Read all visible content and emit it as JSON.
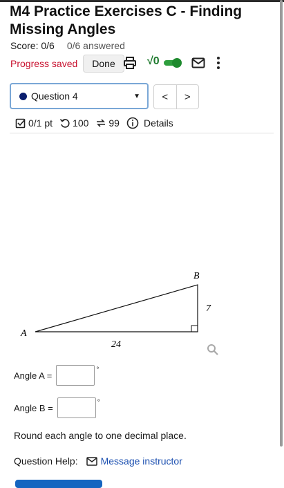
{
  "header": {
    "title": "M4 Practice Exercises C - Finding Missing Angles",
    "score": "Score: 0/6",
    "answered": "0/6 answered",
    "progress_saved": "Progress saved",
    "done_label": "Done",
    "sqrt_label": "√0",
    "icons": [
      "printer-icon",
      "toggle-switch",
      "mail-icon",
      "kebab-menu-icon"
    ]
  },
  "question_nav": {
    "selected": "Question 4",
    "prev_label": "<",
    "next_label": ">"
  },
  "stats": {
    "points": "0/1 pt",
    "attempts": "100",
    "retries": "99",
    "details": "Details"
  },
  "figure": {
    "vertex_a": "A",
    "vertex_b": "B",
    "side_vertical": "7",
    "side_base": "24"
  },
  "answers": {
    "angle_a_label": "Angle A =",
    "angle_b_label": "Angle B =",
    "degree_symbol": "°",
    "angle_a_value": "",
    "angle_b_value": ""
  },
  "instruction": "Round each angle to one decimal place.",
  "help": {
    "label": "Question Help:",
    "message_instructor": "Message instructor"
  },
  "colors": {
    "accent_red": "#c8102e",
    "toggle_green": "#2e9e3d",
    "link_blue": "#1b4fb0",
    "dot_navy": "#0a1e6e"
  }
}
